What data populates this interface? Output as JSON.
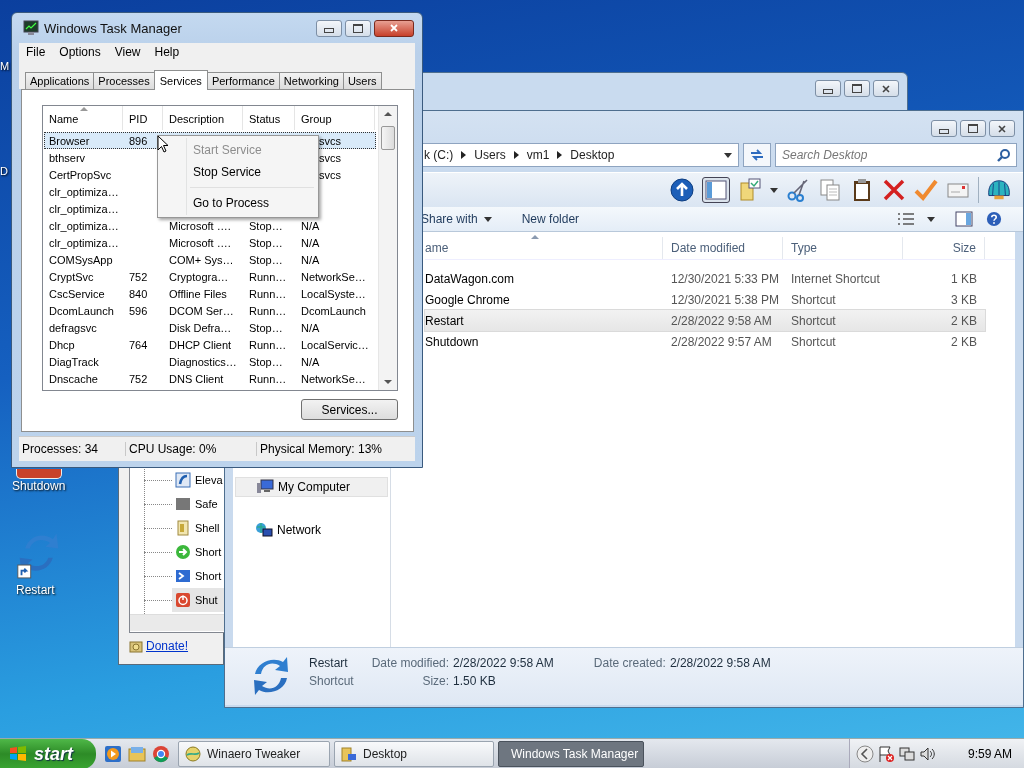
{
  "desktop": {
    "icons": [
      {
        "label": "M",
        "kind": "label"
      },
      {
        "label": "D",
        "kind": "label"
      },
      {
        "label": "Shutdown",
        "kind": "shutdown"
      },
      {
        "label": "Restart",
        "kind": "restart"
      }
    ]
  },
  "tweaker": {
    "tree": [
      {
        "label": "Eleva",
        "kind": "shield",
        "selected": false
      },
      {
        "label": "Safe",
        "kind": "gray",
        "selected": false
      },
      {
        "label": "Shell",
        "kind": "file",
        "selected": false
      },
      {
        "label": "Short",
        "kind": "arrow",
        "selected": false
      },
      {
        "label": "Short",
        "kind": "prompt",
        "selected": false
      },
      {
        "label": "Shut",
        "kind": "power",
        "selected": true
      }
    ],
    "link": "Donate!"
  },
  "explorer": {
    "address": [
      "k (C:)",
      "Users",
      "vm1",
      "Desktop"
    ],
    "search": {
      "placeholder": "Search Desktop"
    },
    "commands": [
      {
        "label": "Share with",
        "dropdown": true
      },
      {
        "label": "New folder",
        "dropdown": false
      }
    ],
    "columns": [
      "ame",
      "Date modified",
      "Type",
      "Size"
    ],
    "files": [
      {
        "name": "DataWagon.com",
        "date": "12/30/2021 5:33 PM",
        "type": "Internet Shortcut",
        "size": "1 KB",
        "selected": false
      },
      {
        "name": "Google Chrome",
        "date": "12/30/2021 5:38 PM",
        "type": "Shortcut",
        "size": "3 KB",
        "selected": false
      },
      {
        "name": "Restart",
        "date": "2/28/2022 9:58 AM",
        "type": "Shortcut",
        "size": "2 KB",
        "selected": true
      },
      {
        "name": "Shutdown",
        "date": "2/28/2022 9:57 AM",
        "type": "Shortcut",
        "size": "2 KB",
        "selected": false
      }
    ],
    "nav": [
      {
        "label": "My Computer",
        "kind": "computer",
        "selected": true
      },
      {
        "label": "Network",
        "kind": "network",
        "selected": false
      }
    ],
    "details": {
      "name": "Restart",
      "type": "Shortcut",
      "fields": [
        {
          "label": "Date modified:",
          "value": "2/28/2022 9:58 AM"
        },
        {
          "label": "Date created:",
          "value": "2/28/2022 9:58 AM"
        },
        {
          "label": "Size:",
          "value": "1.50 KB"
        }
      ]
    }
  },
  "task_manager": {
    "title": "Windows Task Manager",
    "menu": [
      "File",
      "Options",
      "View",
      "Help"
    ],
    "tabs": [
      {
        "label": "Applications",
        "selected": false
      },
      {
        "label": "Processes",
        "selected": false
      },
      {
        "label": "Services",
        "selected": true
      },
      {
        "label": "Performance",
        "selected": false
      },
      {
        "label": "Networking",
        "selected": false
      },
      {
        "label": "Users",
        "selected": false
      }
    ],
    "columns": [
      "Name",
      "PID",
      "Description",
      "Status",
      "Group"
    ],
    "rows": [
      {
        "name": "Browser",
        "pid": "896",
        "group": "svcs",
        "selected": true
      },
      {
        "name": "bthserv",
        "group": "svcs",
        "selected": false
      },
      {
        "name": "CertPropSvc",
        "group": "svcs",
        "selected": false
      },
      {
        "name": "clr_optimiza…",
        "selected": false
      },
      {
        "name": "clr_optimiza…",
        "selected": false
      },
      {
        "name": "clr_optimiza…",
        "description": "Microsoft ….",
        "status": "Stop…",
        "group": "N/A",
        "selected": false
      },
      {
        "name": "clr_optimiza…",
        "description": "Microsoft ….",
        "status": "Stop…",
        "group": "N/A",
        "selected": false
      },
      {
        "name": "COMSysApp",
        "description": "COM+ Sys…",
        "status": "Stop…",
        "group": "N/A",
        "selected": false
      },
      {
        "name": "CryptSvc",
        "pid": "752",
        "description": "Cryptogra…",
        "status": "Runn…",
        "group": "NetworkSe…",
        "selected": false
      },
      {
        "name": "CscService",
        "pid": "840",
        "description": "Offline Files",
        "status": "Runn…",
        "group": "LocalSyste…",
        "selected": false
      },
      {
        "name": "DcomLaunch",
        "pid": "596",
        "description": "DCOM Ser…",
        "status": "Runn…",
        "group": "DcomLaunch",
        "selected": false
      },
      {
        "name": "defragsvc",
        "description": "Disk Defra…",
        "status": "Stop…",
        "group": "N/A",
        "selected": false
      },
      {
        "name": "Dhcp",
        "pid": "764",
        "description": "DHCP Client",
        "status": "Runn…",
        "group": "LocalServic…",
        "selected": false
      },
      {
        "name": "DiagTrack",
        "description": "Diagnostics…",
        "status": "Stop…",
        "group": "N/A",
        "selected": false
      },
      {
        "name": "Dnscache",
        "pid": "752",
        "description": "DNS Client",
        "status": "Runn…",
        "group": "NetworkSe…",
        "selected": false
      }
    ],
    "context_menu": [
      {
        "kind": "item",
        "label": "Start Service",
        "disabled": true
      },
      {
        "kind": "item",
        "label": "Stop Service",
        "disabled": false
      },
      {
        "kind": "separator"
      },
      {
        "kind": "item",
        "label": "Go to Process",
        "disabled": false
      }
    ],
    "button": "Services...",
    "status_bar": [
      "Processes: 34",
      "CPU Usage: 0%",
      "Physical Memory: 13%"
    ]
  },
  "taskbar": {
    "start": "start",
    "tasks": [
      {
        "label": "Winaero Tweaker",
        "kind": "tweaker",
        "selected": false
      },
      {
        "label": "Desktop",
        "kind": "folder",
        "selected": false
      },
      {
        "label": "Windows Task Manager",
        "kind": "monitor",
        "selected": true
      }
    ],
    "clock": "9:59 AM"
  }
}
